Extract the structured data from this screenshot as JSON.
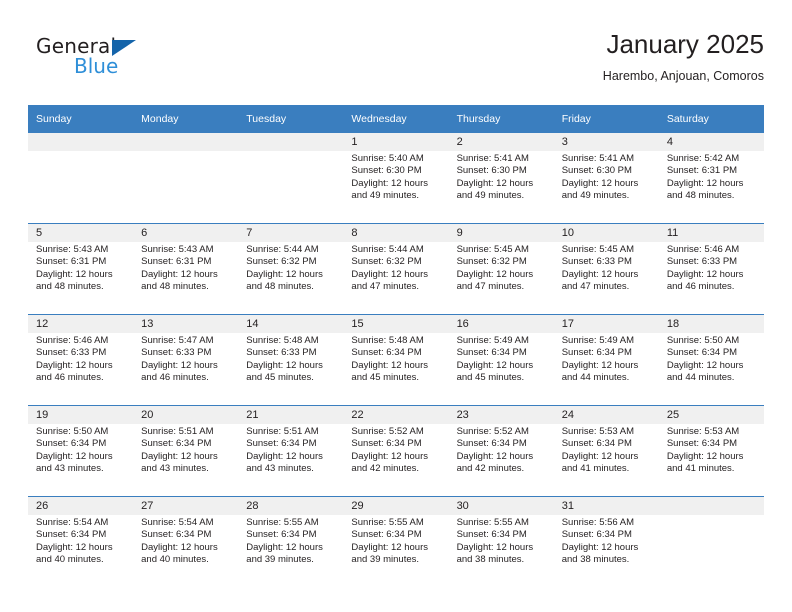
{
  "brand": {
    "name_top": "General",
    "name_bottom": "Blue",
    "accent_color": "#1464aa",
    "accent_color_light": "#2f8fd8"
  },
  "header": {
    "title": "January 2025",
    "subtitle": "Harembo, Anjouan, Comoros"
  },
  "theme": {
    "header_row_color": "#3a7ebf",
    "daynum_band_color": "#f0f0f0",
    "text_color": "#231f20"
  },
  "weekdays": [
    "Sunday",
    "Monday",
    "Tuesday",
    "Wednesday",
    "Thursday",
    "Friday",
    "Saturday"
  ],
  "weeks": [
    [
      {
        "day": "",
        "lines": []
      },
      {
        "day": "",
        "lines": []
      },
      {
        "day": "",
        "lines": []
      },
      {
        "day": "1",
        "lines": [
          "Sunrise: 5:40 AM",
          "Sunset: 6:30 PM",
          "Daylight: 12 hours",
          "and 49 minutes."
        ]
      },
      {
        "day": "2",
        "lines": [
          "Sunrise: 5:41 AM",
          "Sunset: 6:30 PM",
          "Daylight: 12 hours",
          "and 49 minutes."
        ]
      },
      {
        "day": "3",
        "lines": [
          "Sunrise: 5:41 AM",
          "Sunset: 6:30 PM",
          "Daylight: 12 hours",
          "and 49 minutes."
        ]
      },
      {
        "day": "4",
        "lines": [
          "Sunrise: 5:42 AM",
          "Sunset: 6:31 PM",
          "Daylight: 12 hours",
          "and 48 minutes."
        ]
      }
    ],
    [
      {
        "day": "5",
        "lines": [
          "Sunrise: 5:43 AM",
          "Sunset: 6:31 PM",
          "Daylight: 12 hours",
          "and 48 minutes."
        ]
      },
      {
        "day": "6",
        "lines": [
          "Sunrise: 5:43 AM",
          "Sunset: 6:31 PM",
          "Daylight: 12 hours",
          "and 48 minutes."
        ]
      },
      {
        "day": "7",
        "lines": [
          "Sunrise: 5:44 AM",
          "Sunset: 6:32 PM",
          "Daylight: 12 hours",
          "and 48 minutes."
        ]
      },
      {
        "day": "8",
        "lines": [
          "Sunrise: 5:44 AM",
          "Sunset: 6:32 PM",
          "Daylight: 12 hours",
          "and 47 minutes."
        ]
      },
      {
        "day": "9",
        "lines": [
          "Sunrise: 5:45 AM",
          "Sunset: 6:32 PM",
          "Daylight: 12 hours",
          "and 47 minutes."
        ]
      },
      {
        "day": "10",
        "lines": [
          "Sunrise: 5:45 AM",
          "Sunset: 6:33 PM",
          "Daylight: 12 hours",
          "and 47 minutes."
        ]
      },
      {
        "day": "11",
        "lines": [
          "Sunrise: 5:46 AM",
          "Sunset: 6:33 PM",
          "Daylight: 12 hours",
          "and 46 minutes."
        ]
      }
    ],
    [
      {
        "day": "12",
        "lines": [
          "Sunrise: 5:46 AM",
          "Sunset: 6:33 PM",
          "Daylight: 12 hours",
          "and 46 minutes."
        ]
      },
      {
        "day": "13",
        "lines": [
          "Sunrise: 5:47 AM",
          "Sunset: 6:33 PM",
          "Daylight: 12 hours",
          "and 46 minutes."
        ]
      },
      {
        "day": "14",
        "lines": [
          "Sunrise: 5:48 AM",
          "Sunset: 6:33 PM",
          "Daylight: 12 hours",
          "and 45 minutes."
        ]
      },
      {
        "day": "15",
        "lines": [
          "Sunrise: 5:48 AM",
          "Sunset: 6:34 PM",
          "Daylight: 12 hours",
          "and 45 minutes."
        ]
      },
      {
        "day": "16",
        "lines": [
          "Sunrise: 5:49 AM",
          "Sunset: 6:34 PM",
          "Daylight: 12 hours",
          "and 45 minutes."
        ]
      },
      {
        "day": "17",
        "lines": [
          "Sunrise: 5:49 AM",
          "Sunset: 6:34 PM",
          "Daylight: 12 hours",
          "and 44 minutes."
        ]
      },
      {
        "day": "18",
        "lines": [
          "Sunrise: 5:50 AM",
          "Sunset: 6:34 PM",
          "Daylight: 12 hours",
          "and 44 minutes."
        ]
      }
    ],
    [
      {
        "day": "19",
        "lines": [
          "Sunrise: 5:50 AM",
          "Sunset: 6:34 PM",
          "Daylight: 12 hours",
          "and 43 minutes."
        ]
      },
      {
        "day": "20",
        "lines": [
          "Sunrise: 5:51 AM",
          "Sunset: 6:34 PM",
          "Daylight: 12 hours",
          "and 43 minutes."
        ]
      },
      {
        "day": "21",
        "lines": [
          "Sunrise: 5:51 AM",
          "Sunset: 6:34 PM",
          "Daylight: 12 hours",
          "and 43 minutes."
        ]
      },
      {
        "day": "22",
        "lines": [
          "Sunrise: 5:52 AM",
          "Sunset: 6:34 PM",
          "Daylight: 12 hours",
          "and 42 minutes."
        ]
      },
      {
        "day": "23",
        "lines": [
          "Sunrise: 5:52 AM",
          "Sunset: 6:34 PM",
          "Daylight: 12 hours",
          "and 42 minutes."
        ]
      },
      {
        "day": "24",
        "lines": [
          "Sunrise: 5:53 AM",
          "Sunset: 6:34 PM",
          "Daylight: 12 hours",
          "and 41 minutes."
        ]
      },
      {
        "day": "25",
        "lines": [
          "Sunrise: 5:53 AM",
          "Sunset: 6:34 PM",
          "Daylight: 12 hours",
          "and 41 minutes."
        ]
      }
    ],
    [
      {
        "day": "26",
        "lines": [
          "Sunrise: 5:54 AM",
          "Sunset: 6:34 PM",
          "Daylight: 12 hours",
          "and 40 minutes."
        ]
      },
      {
        "day": "27",
        "lines": [
          "Sunrise: 5:54 AM",
          "Sunset: 6:34 PM",
          "Daylight: 12 hours",
          "and 40 minutes."
        ]
      },
      {
        "day": "28",
        "lines": [
          "Sunrise: 5:55 AM",
          "Sunset: 6:34 PM",
          "Daylight: 12 hours",
          "and 39 minutes."
        ]
      },
      {
        "day": "29",
        "lines": [
          "Sunrise: 5:55 AM",
          "Sunset: 6:34 PM",
          "Daylight: 12 hours",
          "and 39 minutes."
        ]
      },
      {
        "day": "30",
        "lines": [
          "Sunrise: 5:55 AM",
          "Sunset: 6:34 PM",
          "Daylight: 12 hours",
          "and 38 minutes."
        ]
      },
      {
        "day": "31",
        "lines": [
          "Sunrise: 5:56 AM",
          "Sunset: 6:34 PM",
          "Daylight: 12 hours",
          "and 38 minutes."
        ]
      },
      {
        "day": "",
        "lines": []
      }
    ]
  ]
}
